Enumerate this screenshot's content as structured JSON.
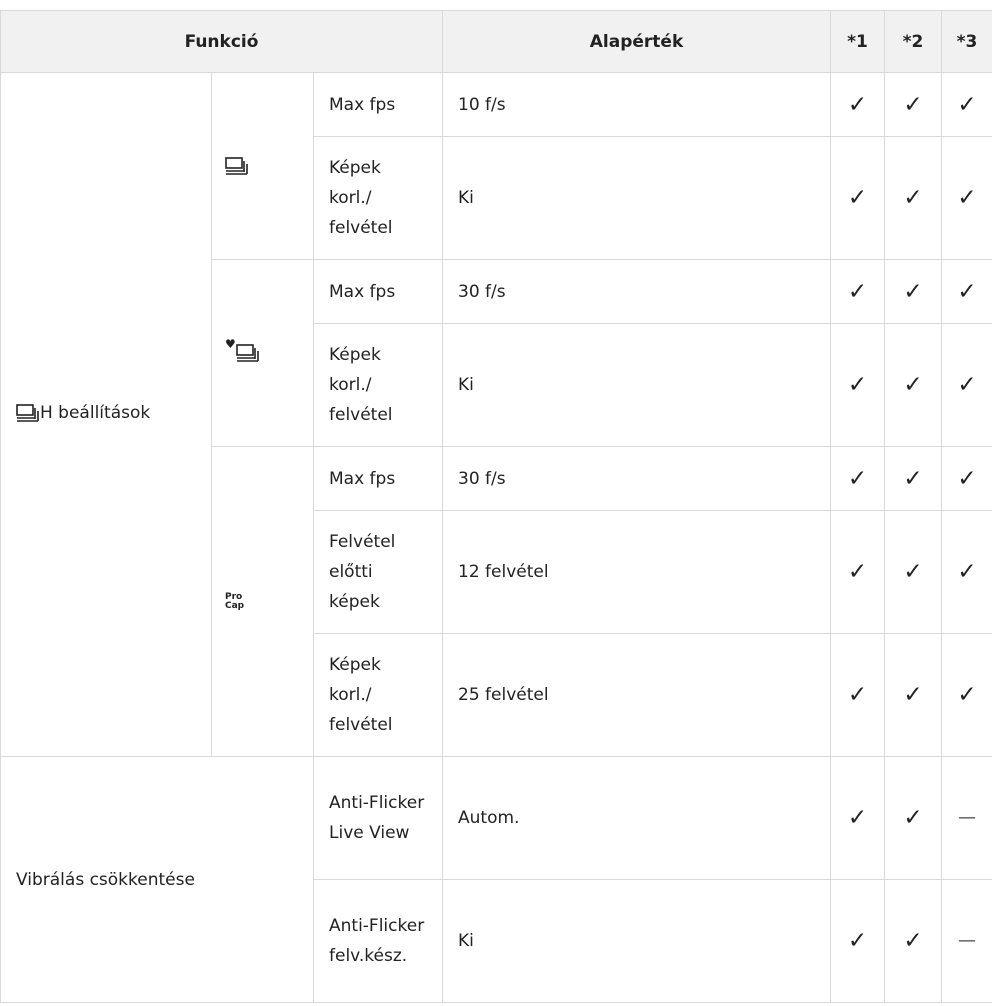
{
  "header": {
    "funkcio": "Funkció",
    "alapertek": "Alapérték",
    "col1": "*1",
    "col2": "*2",
    "col3": "*3"
  },
  "groups": {
    "h_settings": {
      "label": "H beállítások",
      "icon": "sequential-shooting-icon"
    },
    "flicker": {
      "label": "Vibrálás csökkentése"
    }
  },
  "subgroups": {
    "burst": {
      "icon": "sequential-shooting-icon"
    },
    "silent_burst": {
      "icon": "silent-sequential-shooting-icon",
      "heart": "♥"
    },
    "procap": {
      "icon": "pro-capture-icon",
      "line1": "Pro",
      "line2": "Cap"
    }
  },
  "rows": [
    {
      "setting": "Max fps",
      "default": "10 f/s",
      "c1": "✓",
      "c2": "✓",
      "c3": "✓"
    },
    {
      "setting": "Képek korl./ felvétel",
      "default": "Ki",
      "c1": "✓",
      "c2": "✓",
      "c3": "✓"
    },
    {
      "setting": "Max fps",
      "default": "30 f/s",
      "c1": "✓",
      "c2": "✓",
      "c3": "✓"
    },
    {
      "setting": "Képek korl./ felvétel",
      "default": "Ki",
      "c1": "✓",
      "c2": "✓",
      "c3": "✓"
    },
    {
      "setting": "Max fps",
      "default": "30 f/s",
      "c1": "✓",
      "c2": "✓",
      "c3": "✓"
    },
    {
      "setting": "Felvétel előtti képek",
      "default": "12 felvétel",
      "c1": "✓",
      "c2": "✓",
      "c3": "✓"
    },
    {
      "setting": "Képek korl./ felvétel",
      "default": "25 felvétel",
      "c1": "✓",
      "c2": "✓",
      "c3": "✓"
    },
    {
      "setting": "Anti-Flicker Live View",
      "default": "Autom.",
      "c1": "✓",
      "c2": "✓",
      "c3": "—"
    },
    {
      "setting": "Anti-Flicker felv.kész.",
      "default": "Ki",
      "c1": "✓",
      "c2": "✓",
      "c3": "—"
    }
  ]
}
